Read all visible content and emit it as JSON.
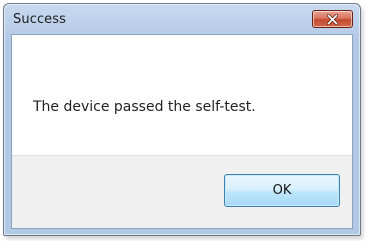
{
  "window": {
    "title": "Success",
    "close_icon": "close-icon"
  },
  "dialog": {
    "message": "The device passed the self-test.",
    "ok_label": "OK"
  },
  "colors": {
    "titlebar": "#bcd0ea",
    "close_button": "#c24a2e",
    "button_bar": "#f0f0f0",
    "ok_border": "#3c7fb1"
  }
}
